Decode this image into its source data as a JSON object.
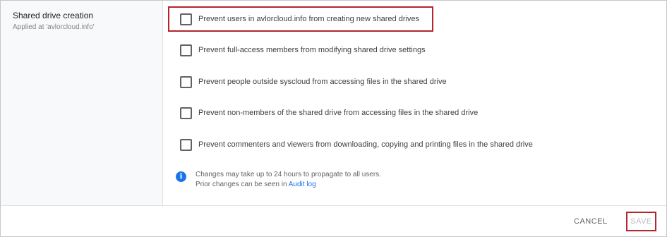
{
  "section": {
    "title": "Shared drive creation",
    "subtitle": "Applied at 'avlorcloud.info'"
  },
  "options": [
    {
      "label": "Prevent users in avlorcloud.info from creating new shared drives",
      "checked": false,
      "highlighted": true
    },
    {
      "label": "Prevent full-access members from modifying shared drive settings",
      "checked": false
    },
    {
      "label": "Prevent people outside syscloud from accessing files in the shared drive",
      "checked": false
    },
    {
      "label": "Prevent non-members of the shared drive from accessing files in the shared drive",
      "checked": false
    },
    {
      "label": "Prevent commenters and viewers from downloading, copying and printing files in the shared drive",
      "checked": false
    }
  ],
  "info": {
    "icon": "info-icon",
    "line1": "Changes may take up to 24 hours to propagate to all users.",
    "line2_prefix": "Prior changes can be seen in ",
    "link": "Audit log"
  },
  "footer": {
    "cancel_label": "CANCEL",
    "save_label": "SAVE"
  },
  "colors": {
    "highlight": "#b3262d",
    "link": "#1a73e8",
    "sidebar_bg": "#f8f9fa"
  }
}
